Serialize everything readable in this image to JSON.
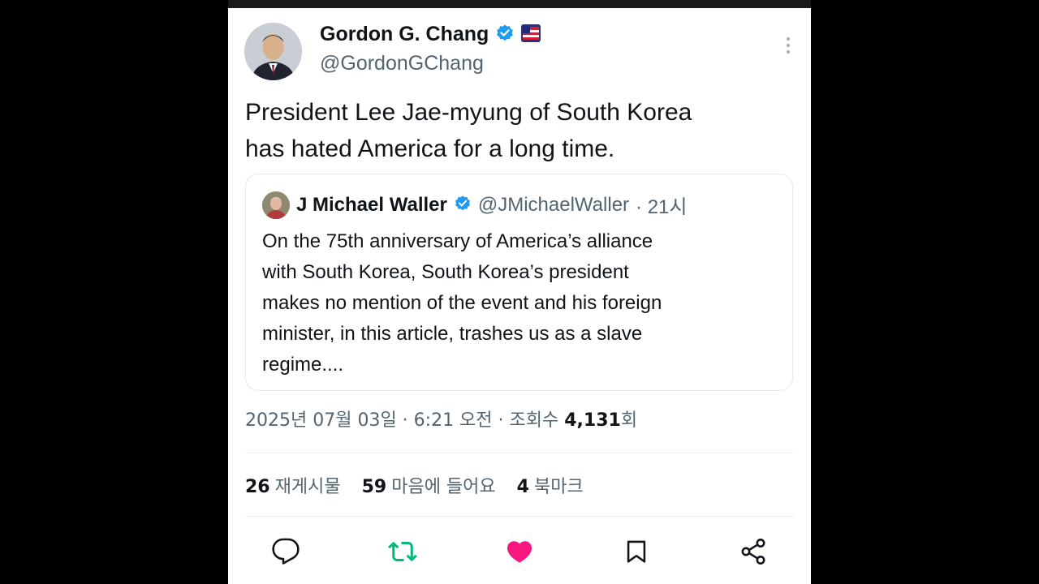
{
  "author": {
    "name": "Gordon G. Chang",
    "handle": "@GordonGChang"
  },
  "tweet": {
    "text_line1": "President Lee Jae-myung of South Korea",
    "text_line2": "has hated America for a long time."
  },
  "quote": {
    "name": "J Michael Waller",
    "handle": "@JMichaelWaller",
    "time": "· 21시",
    "lines": [
      "On the 75th anniversary of America’s alliance",
      "with South Korea, South Korea’s president",
      "makes no mention of the event and his foreign",
      "minister, in this article, trashes us as a slave",
      "regime...."
    ]
  },
  "meta": {
    "datetime": "2025년 07월 03일 · 6:21 오전 · 조회수 ",
    "views": "4,131",
    "views_suffix": "회"
  },
  "stats": {
    "reposts_count": "26",
    "reposts_label": "재게시물",
    "likes_count": "59",
    "likes_label": "마음에 들어요",
    "bookmarks_count": "4",
    "bookmarks_label": "북마크"
  },
  "icons": {
    "verified": "verified-badge-icon",
    "affiliate": "affiliate-flag-icon",
    "more": "more-options-icon",
    "reply": "reply-icon",
    "repost": "repost-icon",
    "like": "heart-icon",
    "bookmark": "bookmark-icon",
    "share": "share-icon"
  },
  "colors": {
    "verified": "#1d9bf0",
    "repost": "#00ba7c",
    "like": "#f91880",
    "text": "#0f1419",
    "muted": "#536471"
  }
}
